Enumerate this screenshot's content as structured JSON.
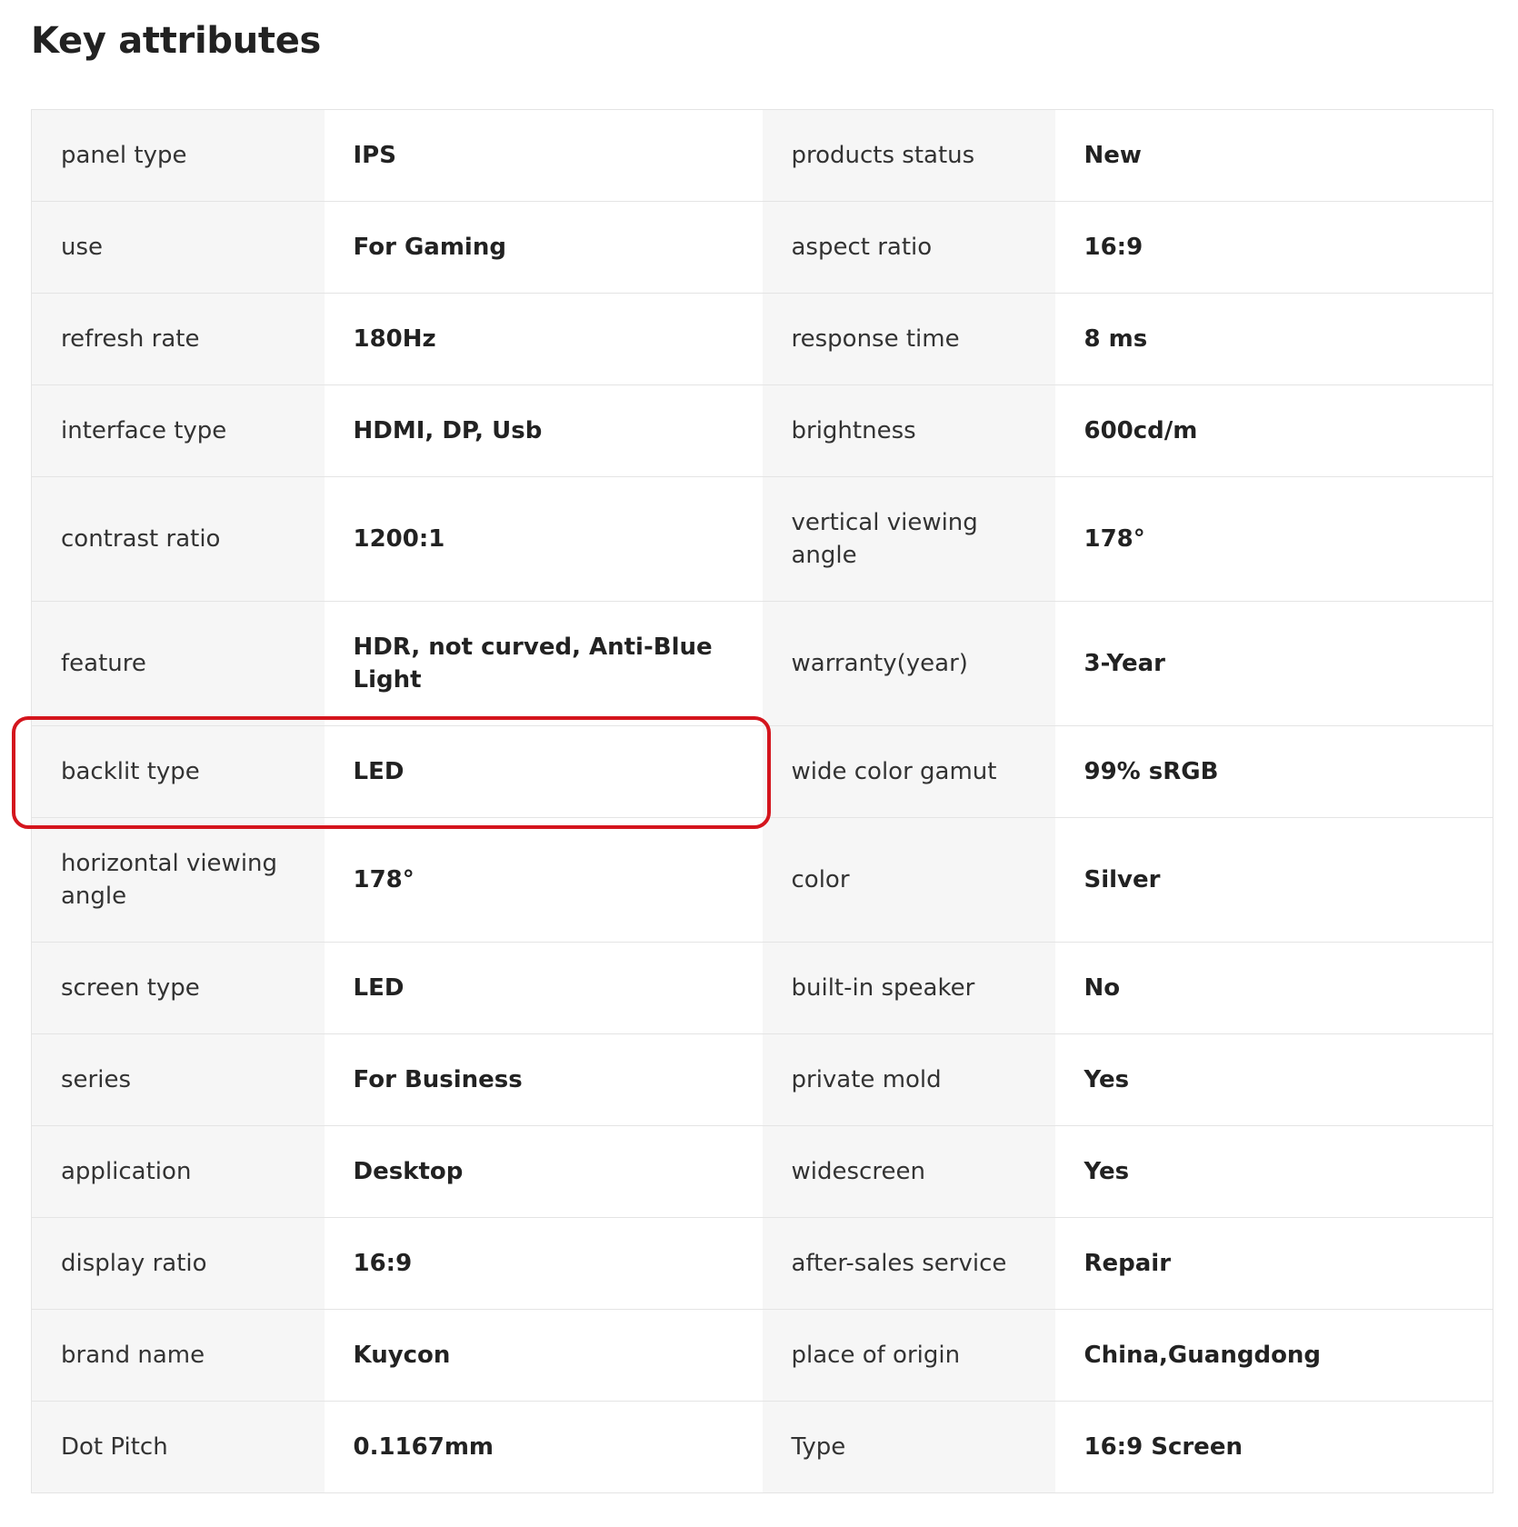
{
  "title": "Key attributes",
  "highlight_color": "#d4151d",
  "rows": [
    [
      {
        "label": "panel type",
        "value": "IPS"
      },
      {
        "label": "products status",
        "value": "New"
      }
    ],
    [
      {
        "label": "use",
        "value": "For Gaming"
      },
      {
        "label": "aspect ratio",
        "value": "16:9"
      }
    ],
    [
      {
        "label": "refresh rate",
        "value": "180Hz"
      },
      {
        "label": "response time",
        "value": "8 ms"
      }
    ],
    [
      {
        "label": "interface type",
        "value": "HDMI, DP, Usb"
      },
      {
        "label": "brightness",
        "value": "600cd/m"
      }
    ],
    [
      {
        "label": "contrast ratio",
        "value": "1200:1"
      },
      {
        "label": "vertical viewing angle",
        "value": "178°"
      }
    ],
    [
      {
        "label": "feature",
        "value": "HDR, not curved, Anti-Blue Light"
      },
      {
        "label": "warranty(year)",
        "value": "3-Year"
      }
    ],
    [
      {
        "label": "backlit type",
        "value": "LED"
      },
      {
        "label": "wide color gamut",
        "value": "99% sRGB"
      }
    ],
    [
      {
        "label": "horizontal viewing angle",
        "value": "178°"
      },
      {
        "label": "color",
        "value": "Silver"
      }
    ],
    [
      {
        "label": "screen type",
        "value": "LED"
      },
      {
        "label": "built-in speaker",
        "value": "No"
      }
    ],
    [
      {
        "label": "series",
        "value": "For Business"
      },
      {
        "label": "private mold",
        "value": "Yes"
      }
    ],
    [
      {
        "label": "application",
        "value": "Desktop"
      },
      {
        "label": "widescreen",
        "value": "Yes"
      }
    ],
    [
      {
        "label": "display ratio",
        "value": "16:9"
      },
      {
        "label": "after-sales service",
        "value": "Repair"
      }
    ],
    [
      {
        "label": "brand name",
        "value": "Kuycon"
      },
      {
        "label": "place of origin",
        "value": "China,Guangdong"
      }
    ],
    [
      {
        "label": "Dot Pitch",
        "value": "0.1167mm"
      },
      {
        "label": "Type",
        "value": "16:9 Screen"
      }
    ]
  ]
}
